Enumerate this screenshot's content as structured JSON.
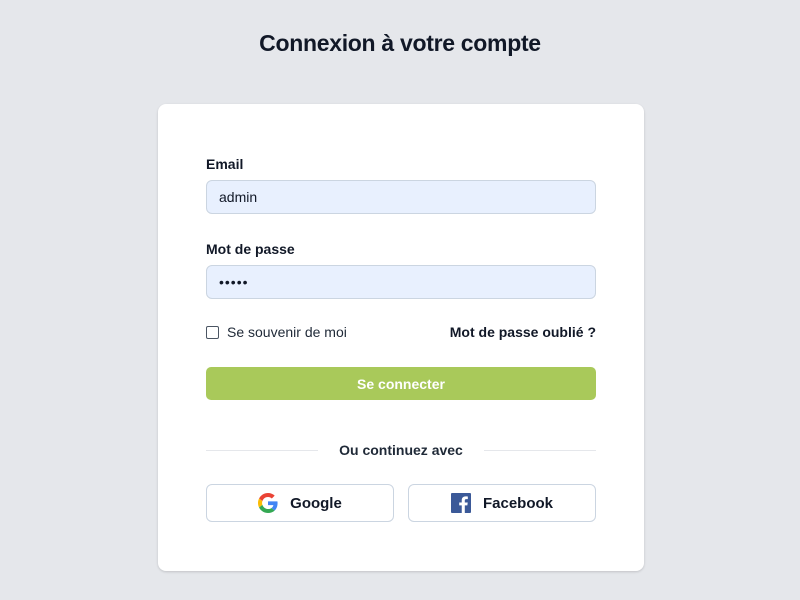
{
  "page": {
    "title": "Connexion à votre compte"
  },
  "form": {
    "email_label": "Email",
    "email_value": "admin",
    "password_label": "Mot de passe",
    "password_value": "•••••",
    "remember_label": "Se souvenir de moi",
    "remember_checked": false,
    "forgot_link": "Mot de passe oublié ?",
    "submit_label": "Se connecter"
  },
  "social": {
    "divider_text": "Ou continuez avec",
    "google_label": "Google",
    "facebook_label": "Facebook"
  },
  "colors": {
    "background": "#e5e7eb",
    "card": "#ffffff",
    "input_fill": "#e8f0fe",
    "submit_button": "#a9c95a",
    "facebook_blue": "#3b5998"
  },
  "icons": {
    "google": "google-icon",
    "facebook": "facebook-icon"
  }
}
